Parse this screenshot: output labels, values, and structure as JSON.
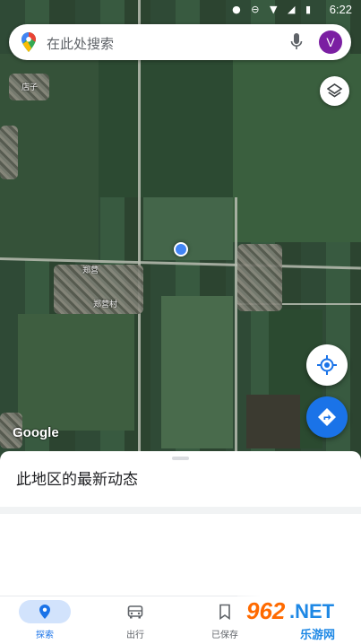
{
  "status_bar": {
    "time": "6:22"
  },
  "search": {
    "placeholder": "在此处搜索",
    "avatar_letter": "V"
  },
  "map": {
    "place_labels": [
      "店子",
      "郑营",
      "郑营村"
    ],
    "attribution": "Google"
  },
  "sheet": {
    "title": "此地区的最新动态"
  },
  "nav": {
    "items": [
      {
        "label": "探索",
        "icon": "pin-icon",
        "active": true
      },
      {
        "label": "出行",
        "icon": "car-icon",
        "active": false
      },
      {
        "label": "已保存",
        "icon": "bookmark-icon",
        "active": false
      }
    ]
  },
  "watermark": {
    "number": "962",
    "net": ".NET",
    "cn": "乐游网"
  },
  "colors": {
    "accent": "#1a73e8",
    "avatar": "#7b1fa2"
  }
}
